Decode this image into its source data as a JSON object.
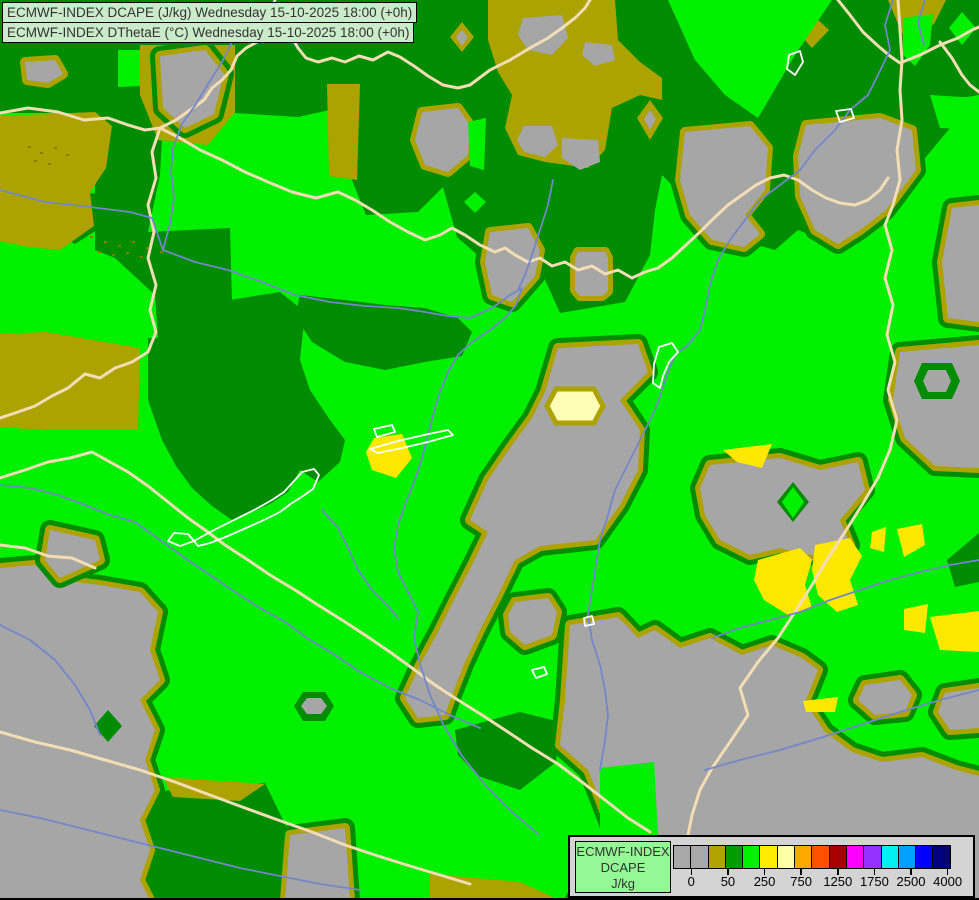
{
  "header": {
    "line1": "ECMWF-INDEX DCAPE (J/kg) Wednesday 15-10-2025 18:00 (+0h)",
    "line2": "ECMWF-INDEX DThetaE (°C) Wednesday 15-10-2025 18:00 (+0h)"
  },
  "legend": {
    "title_line1": "ECMWF-INDEX",
    "title_line2": "DCAPE",
    "title_line3": "J/kg",
    "tick_labels": [
      "0",
      "50",
      "250",
      "750",
      "1250",
      "1750",
      "2500",
      "4000"
    ],
    "swatch_colors": [
      "#a8a8a8",
      "#a8a8a8",
      "#b0a400",
      "#009c00",
      "#00f000",
      "#ffec00",
      "#ffffa8",
      "#ffa800",
      "#ff5000",
      "#a80000",
      "#ff00ff",
      "#9632ff",
      "#00f0f0",
      "#00a0ff",
      "#0000ff",
      "#000080"
    ]
  },
  "palette": {
    "bright_green": "#00f000",
    "dark_green": "#008c00",
    "olive": "#aca300",
    "gray": "#a6a6a6",
    "yellow": "#ffe800",
    "pale_yellow": "#ffffb8",
    "border_line": "#f2ddb5",
    "river": "#7387c9",
    "lake_outline": "#ffffff",
    "dot": "#857d00"
  },
  "map": {
    "dark_green_regions": [
      "M0,0 H979 V95 L950,100 L950,128 L905,182 L868,230 L838,246 L798,230 L775,250 L740,240 L700,214 L662,175 L655,210 L650,255 L625,302 L560,313 L537,262 L497,272 L457,237 L443,187 L418,212 L366,215 L340,150 L330,110 L298,117 L235,113 L233,46 L140,46 L140,50 L118,50 L118,88 L95,88 L95,113 L0,113 Z",
      "M95,88 L165,85 L160,175 L148,232 L230,228 L233,338 L158,338 L155,295 L115,258 L95,250 Z",
      "M148,338 L230,338 L230,300 L280,292 L305,312 L300,360 L310,390 L330,420 L345,440 L340,462 L318,482 L300,470 L288,492 L270,504 L252,512 L232,520 L212,506 L192,488 L176,466 L162,440 L148,400 Z",
      "M300,295 L345,300 L385,305 L425,308 L458,318 L472,332 L462,356 L425,362 L385,370 L345,362 L312,342 L295,316 Z",
      "M150,792 L265,783 L288,830 L288,900 L148,900 Z",
      "M455,730 L520,712 L560,722 L556,762 L520,790 L478,776 L458,755 Z",
      "M947,560 L979,533 L979,582 L955,587 Z",
      "M55,198 L95,193 L100,228 L75,244 L55,234 Z"
    ],
    "olive_regions": [
      "M140,45 L235,45 L235,112 L208,145 L158,140 L140,95 Z",
      "M0,116 L95,112 L112,126 L106,168 L90,192 L94,226 L60,250 L28,247 L0,241 Z",
      "M327,84 L360,84 L357,180 L329,176 Z",
      "M0,334 L46,332 L140,348 L138,430 L44,430 L0,427 Z",
      "M488,0 L615,0 L618,40 L640,62 L662,78 L662,100 L640,95 L612,108 L605,150 L588,168 L545,162 L518,155 L505,128 L512,95 L498,72 L488,40 Z",
      "M812,14 L829,30 L812,48 L796,30 Z",
      "M888,0 H946 L934,24 L905,40 Z",
      "M163,777 L265,784 L240,801 L173,797 Z",
      "M430,874 L520,882 L560,900 L430,900 Z"
    ],
    "gray_blobs": [
      "M160,56 L205,50 L224,74 L214,114 L185,128 L163,108 Z",
      "M25,62 L55,60 L63,74 L48,83 L27,80 Z",
      "M422,112 L458,108 L470,125 L468,155 L448,172 L425,165 L415,140 Z",
      "M806,125 L880,118 L912,130 L916,170 L886,210 L860,230 L838,244 L815,230 L800,196 L798,156 Z",
      "M952,208 L979,205 L979,322 L948,318 L942,262 Z",
      "M900,352 L979,345 L979,468 L935,466 L905,438 L893,400 Z",
      "M685,132 L750,126 L768,148 L765,190 L745,215 L760,234 L744,247 L712,240 L690,215 L680,180 Z",
      "M490,232 L528,228 L540,250 L535,276 L512,302 L492,295 L485,262 Z",
      "M578,252 L605,252 L608,258 L608,291 L602,296 L580,296 L575,290 L575,258 Z",
      "M558,348 L638,344 L648,372 L620,400 L640,430 L638,470 L620,505 L595,540 L540,546 L515,560 L498,595 L480,630 L465,662 L452,695 L445,715 L418,718 L405,698 L420,665 L438,632 L455,598 L472,565 L488,532 L470,520 L488,480 L510,448 L532,418 L545,392 Z",
      "M515,602 L548,598 L557,612 L552,635 L525,645 L510,632 L508,615 Z",
      "M570,625 L618,617 L638,638 L655,630 L680,648 L710,638 L742,655 L772,645 L802,658 L818,670 L805,702 L825,732 L852,752 L882,762 L922,757 L956,770 L979,776 L979,900 L575,900 L598,860 L615,840 L600,800 L588,770 L560,745 L565,700 Z",
      "M865,685 L900,680 L912,695 L905,712 L875,715 L858,700 Z",
      "M945,693 L979,688 L979,728 L950,730 L938,712 Z",
      "M0,568 L35,565 L60,580 L100,585 L140,592 L158,612 L150,650 L160,680 L140,700 L155,730 L145,760 L155,790 L140,820 L150,850 L140,880 L150,900 L0,900 Z",
      "M50,530 L95,540 L100,560 L60,578 L45,560 Z",
      "M290,835 L345,828 L350,900 L285,900 Z",
      "M710,465 L780,458 L820,470 L858,462 L865,490 L840,520 L850,545 L820,557 L780,548 L750,555 L720,540 L705,515 L700,488 Z"
    ],
    "dark_green_overlays": [
      "M108,710 L122,726 L108,742 L94,726 Z",
      "M303,692 L325,692 L334,706 L325,721 L303,721 L294,706 Z",
      "M793,482 L809,502 L793,522 L777,502 Z",
      "M922,363 L952,363 L960,381 L952,399 L922,399 L914,381 Z"
    ],
    "olive_overlays": [
      "M650,100 L663,118 L650,140 L637,118 Z",
      "M462,22 L474,37 L462,52 L450,37 Z"
    ],
    "bright_green_overlays": [
      "M668,0 L832,0 L795,55 L758,118 L725,95 L695,60 Z",
      "M903,18 L933,14 L930,45 L915,66 L903,55 Z",
      "M475,192 L486,202 L475,213 L464,202 Z",
      "M962,12 L976,28 L962,45 L949,28 Z",
      "M600,768 L654,762 L658,835 L600,835 Z",
      "M930,95 L979,98 L979,130 L940,128 Z",
      "M793,487 L804,502 L793,518 L782,502 Z",
      "M468,122 L486,118 L484,170 L470,166 Z"
    ],
    "gray_overlays": [
      "M650,110 L656,119 L650,130 L644,119 Z",
      "M307,698 L321,698 L327,706 L321,714 L307,714 L301,706 Z",
      "M928,370 L946,370 L951,381 L946,392 L928,392 L923,381 Z",
      "M523,18 L562,15 L568,38 L552,55 L528,50 L518,35 Z",
      "M585,42 L612,45 L615,60 L595,66 L582,55 Z",
      "M524,126 L552,126 L558,145 L545,157 L524,152 L517,140 Z",
      "M562,138 L598,140 L600,162 L580,170 L562,158 Z",
      "M462,30 L468,37 L462,46 L456,37 Z"
    ],
    "pale_patches": [
      "M556,389 L594,389 L603,406 L594,423 L556,423 L547,406 Z"
    ],
    "yellow_patches": [
      "M374,438 L402,434 L412,458 L396,478 L372,470 L366,452 Z",
      "M723,450 L772,444 L762,468 L737,462 Z",
      "M758,560 L800,548 L812,560 L805,585 L812,608 L788,615 L764,600 L754,580 Z",
      "M815,545 L850,538 L862,556 L850,580 L858,605 L837,612 L818,595 L812,570 Z",
      "M872,532 L886,527 L884,552 L870,548 Z",
      "M897,529 L922,524 L925,545 L904,557 Z",
      "M904,609 L928,604 L925,633 L904,630 Z",
      "M930,617 L979,611 L979,652 L940,650 Z",
      "M803,701 L838,697 L835,712 L806,712 Z"
    ],
    "borders": [
      "M0,113 L28,108 L58,112 L84,120 L108,118 L128,125 L145,130 L160,128 L176,120 L190,110 L204,100 L212,88 L222,80 L231,70 L237,56 L246,48 L257,42 L261,30 L269,22 L272,10 L275,0",
      "M269,22 L282,28 L291,36 L298,48 L306,58 L318,62 L332,58 L345,62 L359,56 L373,60 L388,52 L400,57 L414,66 L428,76 L443,85 L458,88 L470,85 L490,70 L510,60 L530,48 L548,38 L562,28 L575,18 L585,8 L590,0",
      "M160,128 L152,152 L156,178 L148,205 L154,232 L148,258 L156,285 L150,310 L156,332 L148,352 L132,362 L115,368 L100,378 L85,374 L68,388 L52,396 L35,406 L18,412 L0,418",
      "M160,128 L180,138 L200,150 L222,160 L245,172 L268,182 L292,192 L316,198 L338,192 L355,200 L372,210 L390,222 L408,232 L425,240 L440,235 L452,228 L465,235 L480,245 L495,252 L505,248 L515,255 L528,262 L540,258 L552,266 L565,262 L578,270 L592,266 L605,274 L618,270 L632,278 L645,272 L658,268 L672,258 L686,245 L700,232 L714,218 L728,205 L742,195 L756,185 L770,178 L784,175 L798,180 L812,190 L826,198 L840,203 L855,205 L868,200 L880,190 L888,178",
      "M898,0 L900,30 L902,60 L900,90 L902,120 L897,150 L900,180 L893,205 L885,225 L892,250 L885,278 L893,305 L887,335 L895,362 L888,390 L897,420 L890,450 L878,478 L862,505 L845,532 L828,558 L812,585 L795,612 L778,638 L758,662 L740,688 L748,715 L730,742 L712,768 L700,790 L692,815 L688,835",
      "M838,0 L850,15 L863,32 L877,45 L890,56 L900,63 L920,55 L940,45 L958,38 L972,30 L979,27",
      "M940,42 L952,58 L962,75 L970,85 L979,92",
      "M0,478 L25,470 L48,462 L70,458 L92,452 L110,462 L128,472 L148,486 L168,502 L188,518 L205,530 L225,545 L248,560 L270,575 L295,590 L318,605 L342,620 L365,635 L390,652 L412,668 L435,685 L458,700 L482,715 L508,732 L532,748 L558,764 L582,782 L605,800 L628,818 L650,832",
      "M0,545 L25,548 L48,556 L72,558 L95,568",
      "M0,732 L35,742 L70,750 L105,760 L140,770 L175,782 L210,795 L245,808 L278,820 L312,832 L345,845 L378,856 L410,866 L440,875 L470,884"
    ],
    "rivers": [
      "M233,40 L222,62 L208,84 L196,104 L182,124 L173,148 L171,172 L174,198 L170,224 L163,250",
      "M0,190 L45,202 L90,207 L130,212 L152,218 L163,250",
      "M163,250 L195,262 L228,270 L262,282 L295,295 L330,302 L365,306 L398,308 L425,312 L448,316 L470,318 L492,308 L510,295 L522,288 L516,305 L505,318 L490,330 L472,342 L458,355 L448,372 L440,392 L434,412 L428,435 L422,458 L415,480 L406,502 L398,525 L394,548 L398,572 L408,592 L418,612 L414,638 L420,664 L430,695 L444,726 L462,756 L486,786 L512,812 L538,834",
      "M553,180 L548,205 L540,230 L532,255 L525,275 L518,290",
      "M893,0 L885,25 L890,50 L878,75 L868,95 L850,110 L835,130 L815,150 L800,170 L780,185 L760,200 L745,220 L730,240 L718,260 L710,285 L705,310 L700,330 L688,345 L675,355 L668,372 L662,390 L655,410 L645,430 L635,450 L625,470 L615,490 L608,515 L600,540 L596,565 L592,590 L588,615 L592,640 L600,665 L605,690 L608,715 L605,740 L600,770",
      "M979,560 L950,565 L920,572 L890,580 L860,590 L830,600 L800,612 L770,620 L740,628 L712,638",
      "M979,690 L940,700 L900,712 L860,725 L820,738 L780,750 L740,760 L705,770",
      "M0,485 L30,488 L58,495 L85,505 L110,515 L135,522",
      "M135,522 L160,540 L185,558 L210,575 L235,592 L260,608 L285,622 L310,640 L335,655 L360,672 L390,688 L420,700 L450,715 L480,728",
      "M0,810 L40,818 L80,828 L120,838 L160,848 L200,858 L240,868 L280,876 L320,884 L360,890",
      "M0,625 L30,640 L55,660 L75,685 L90,710 L100,735",
      "M925,0 L918,22 L924,45",
      "M322,510 L338,528 L348,548 L358,570 L372,590 L388,606 L398,618"
    ],
    "lakes": [
      "M194,541 L214,530 L236,519 L256,509 L272,500 L284,492 L294,481 L302,472 L314,469 L319,475 L313,489 L303,496 L292,503 L280,512 L264,520 L246,528 L228,536 L210,543 L198,546 Z",
      "M194,541 L180,546 L168,541 L174,533 L188,534 Z",
      "M370,449 L398,441 L424,435 L448,430 L453,435 L428,442 L402,448 L378,453 Z",
      "M374,429 L392,425 L395,432 L377,437 Z",
      "M659,347 L672,343 L678,352 L669,362 L663,376 L660,388 L653,383 L654,364 Z",
      "M789,55 L800,51 L803,62 L795,75 L787,69 Z",
      "M836,111 L851,109 L854,118 L840,122 Z",
      "M584,618 L592,616 L594,624 L585,626 Z",
      "M532,670 L544,667 L547,674 L536,678 Z"
    ],
    "texture_dots": [
      [
        28,
        146
      ],
      [
        40,
        152
      ],
      [
        54,
        147
      ],
      [
        66,
        154
      ],
      [
        34,
        160
      ],
      [
        48,
        163
      ],
      [
        90,
        236
      ],
      [
        104,
        241
      ],
      [
        118,
        245
      ],
      [
        132,
        241
      ],
      [
        146,
        247
      ],
      [
        160,
        251
      ],
      [
        98,
        251
      ],
      [
        112,
        254
      ],
      [
        126,
        252
      ],
      [
        140,
        256
      ]
    ]
  }
}
